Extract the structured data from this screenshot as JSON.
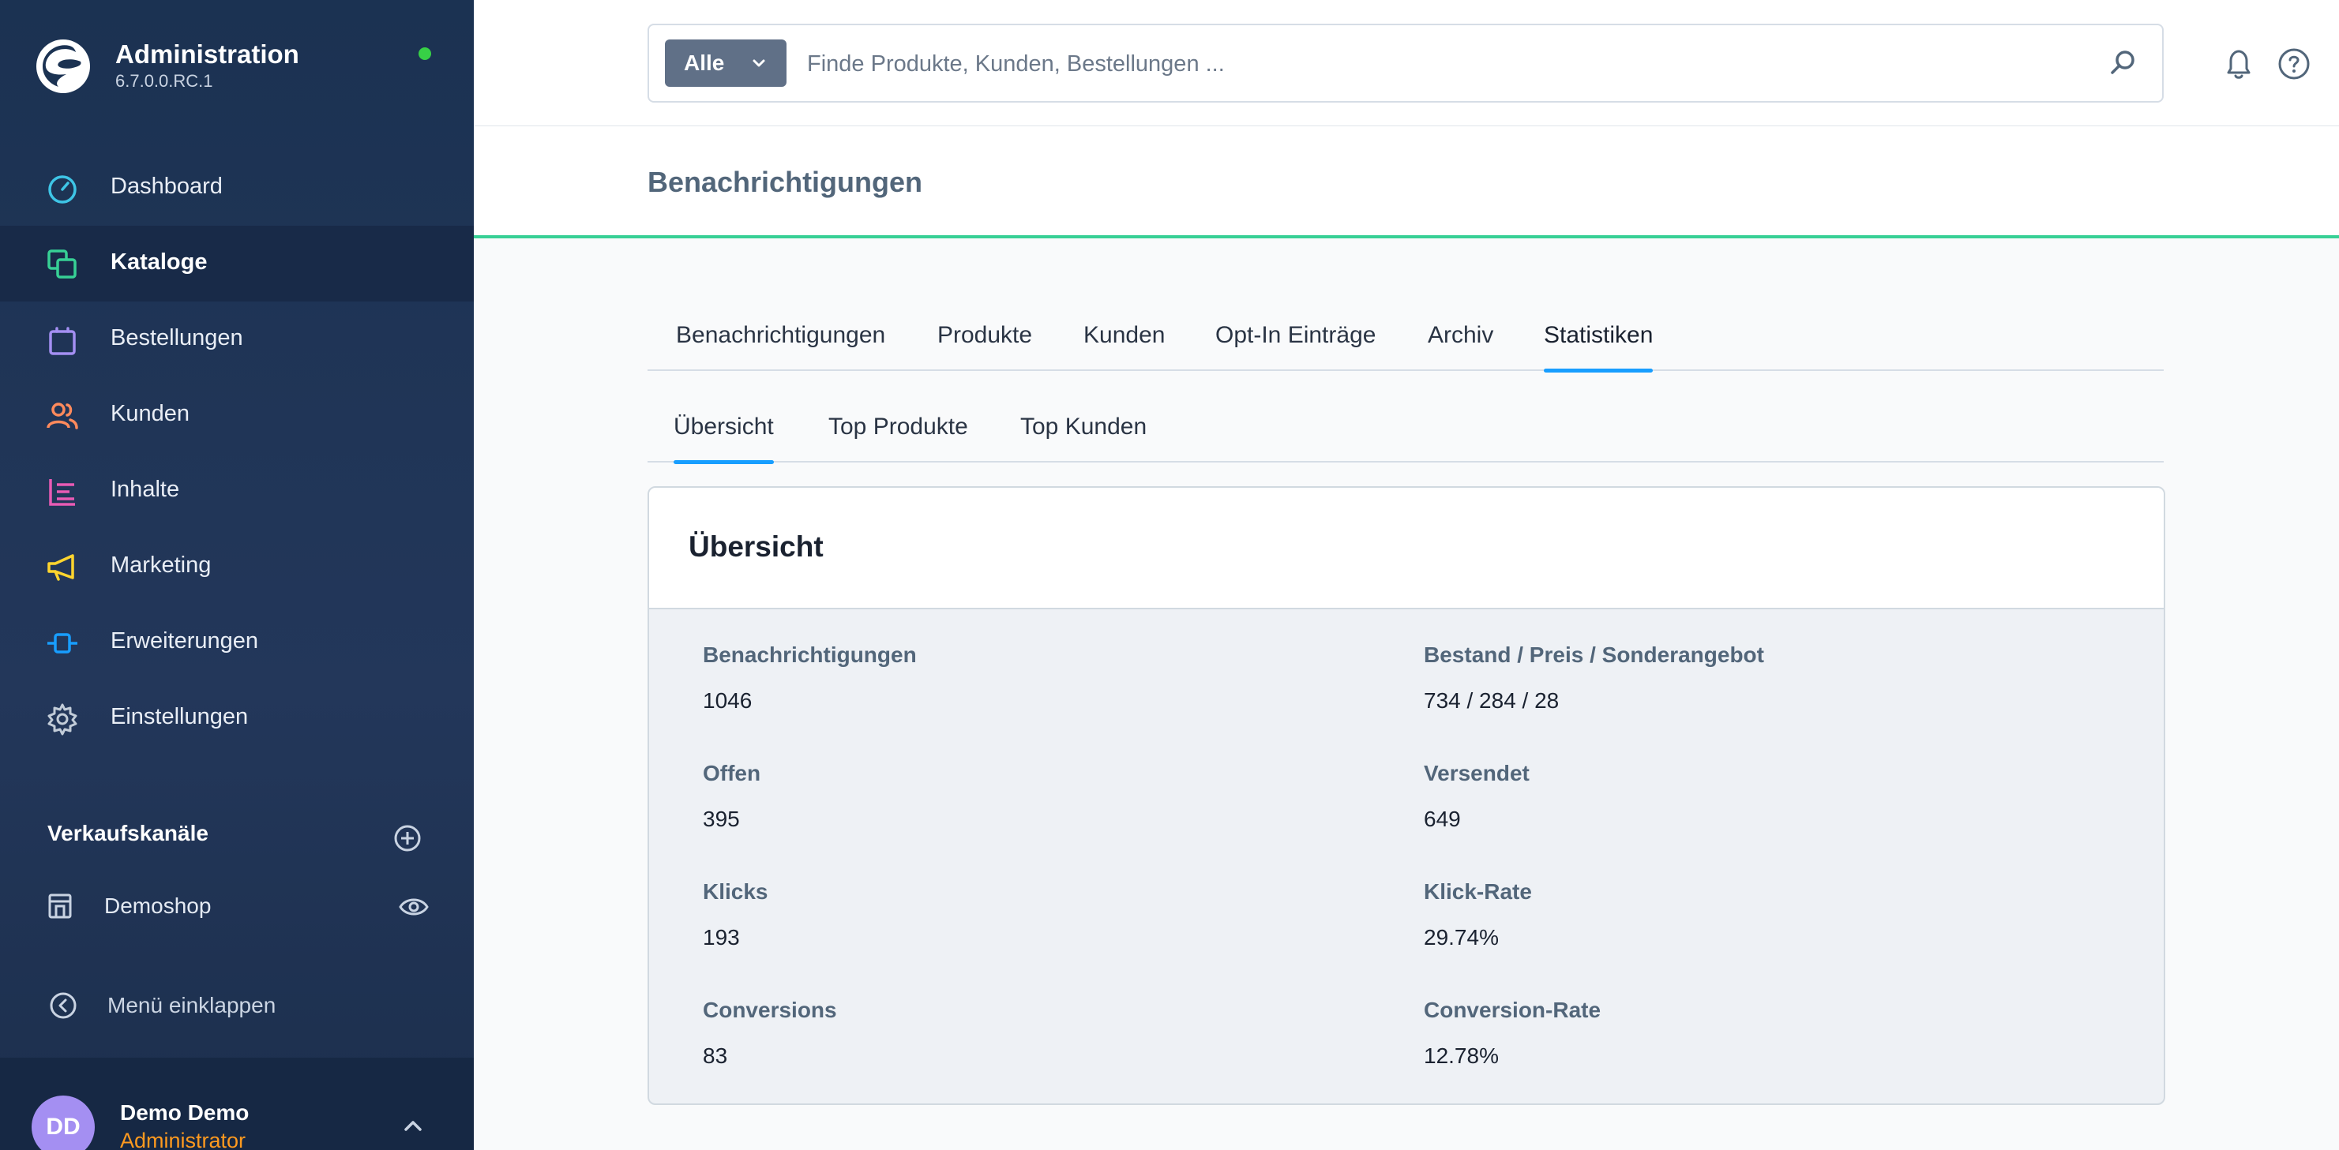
{
  "app": {
    "title": "Administration",
    "version": "6.7.0.0.RC.1"
  },
  "sidebar": {
    "items": [
      {
        "label": "Dashboard",
        "icon": "gauge-icon",
        "color": "#3ec5e6"
      },
      {
        "label": "Kataloge",
        "icon": "catalog-icon",
        "color": "#37d095",
        "active": true
      },
      {
        "label": "Bestellungen",
        "icon": "shopping-bag-icon",
        "color": "#a48ff2"
      },
      {
        "label": "Kunden",
        "icon": "users-icon",
        "color": "#ff8a5c"
      },
      {
        "label": "Inhalte",
        "icon": "content-list-icon",
        "color": "#e85bb4"
      },
      {
        "label": "Marketing",
        "icon": "megaphone-icon",
        "color": "#ffd52e"
      },
      {
        "label": "Erweiterungen",
        "icon": "plug-icon",
        "color": "#189eff"
      },
      {
        "label": "Einstellungen",
        "icon": "gear-icon",
        "color": "#c2ccd8"
      }
    ],
    "channels_title": "Verkaufskanäle",
    "channels": [
      {
        "label": "Demoshop"
      }
    ],
    "collapse_label": "Menü einklappen",
    "user": {
      "initials": "DD",
      "name": "Demo Demo",
      "role": "Administrator"
    }
  },
  "search": {
    "scope": "Alle",
    "placeholder": "Finde Produkte, Kunden, Bestellungen ..."
  },
  "page": {
    "title": "Benachrichtigungen"
  },
  "tabs": [
    {
      "label": "Benachrichtigungen"
    },
    {
      "label": "Produkte"
    },
    {
      "label": "Kunden"
    },
    {
      "label": "Opt-In Einträge"
    },
    {
      "label": "Archiv"
    },
    {
      "label": "Statistiken",
      "active": true
    }
  ],
  "subtabs": [
    {
      "label": "Übersicht",
      "active": true
    },
    {
      "label": "Top Produkte"
    },
    {
      "label": "Top Kunden"
    }
  ],
  "overview": {
    "title": "Übersicht",
    "stats": [
      {
        "label": "Benachrichtigungen",
        "value": "1046"
      },
      {
        "label": "Bestand / Preis / Sonderangebot",
        "value": "734 / 284 / 28"
      },
      {
        "label": "Offen",
        "value": "395"
      },
      {
        "label": "Versendet",
        "value": "649"
      },
      {
        "label": "Klicks",
        "value": "193"
      },
      {
        "label": "Klick-Rate",
        "value": "29.74%"
      },
      {
        "label": "Conversions",
        "value": "83"
      },
      {
        "label": "Conversion-Rate",
        "value": "12.78%"
      }
    ]
  },
  "colors": {
    "accent": "#189eff",
    "brand_green": "#37d095",
    "status_online": "#37d046"
  }
}
